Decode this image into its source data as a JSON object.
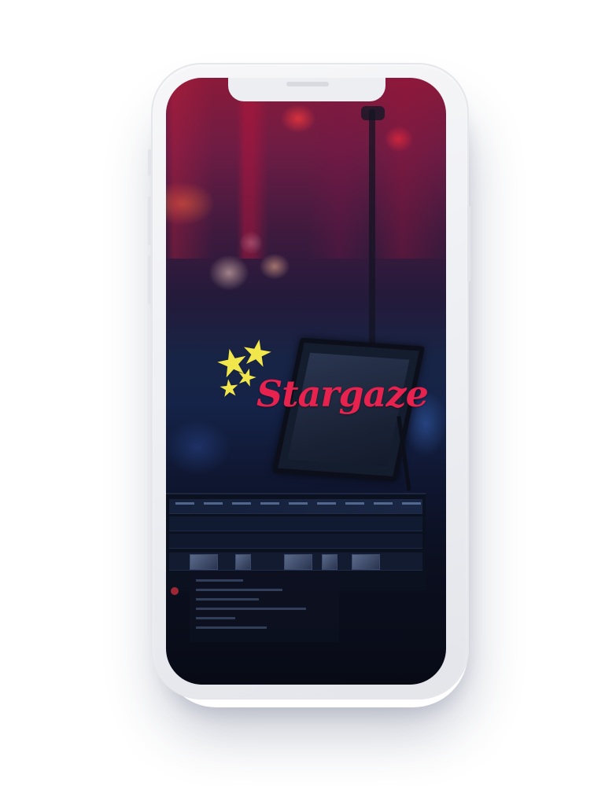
{
  "app": {
    "brand_name": "Stargaze",
    "brand_color": "#e8224e",
    "star_color": "#f1e64c",
    "logo_icon": "stars-icon"
  },
  "device": {
    "frame_color": "#eceef2"
  }
}
